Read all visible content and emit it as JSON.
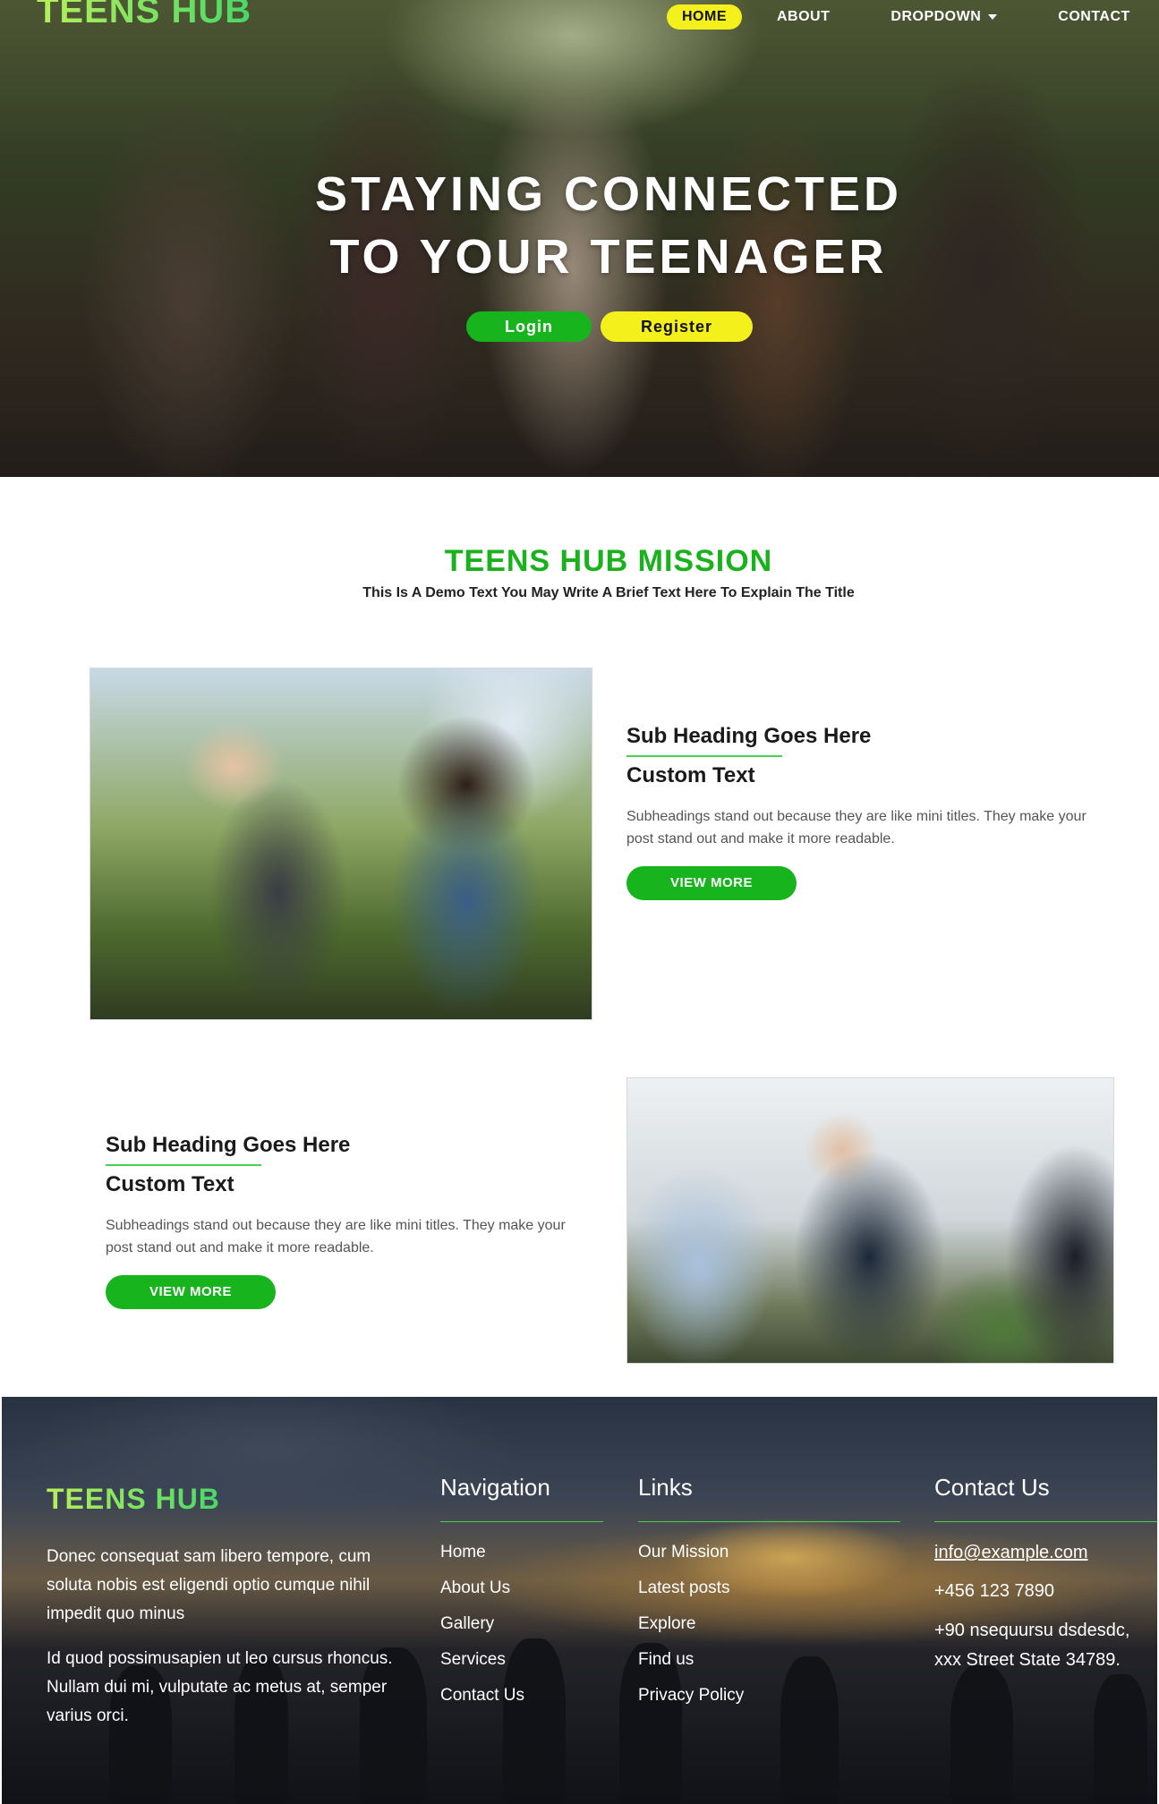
{
  "header": {
    "logo": "TEENS HUB",
    "nav": {
      "home": "HOME",
      "about": "ABOUT",
      "dropdown": "DROPDOWN",
      "contact": "CONTACT"
    }
  },
  "hero": {
    "title_line1": "STAYING CONNECTED",
    "title_line2": "TO YOUR TEENAGER",
    "login_label": "Login",
    "register_label": "Register"
  },
  "mission": {
    "title": "TEENS HUB MISSION",
    "subtitle": "This Is A Demo Text You May Write A Brief Text Here To Explain The Title"
  },
  "features": [
    {
      "sub_heading": "Sub Heading Goes Here",
      "custom_text": "Custom Text",
      "description": "Subheadings stand out because they are like mini titles. They make your post stand out and make it more readable.",
      "button_label": "VIEW MORE"
    },
    {
      "sub_heading": "Sub Heading Goes Here",
      "custom_text": "Custom Text",
      "description": "Subheadings stand out because they are like mini titles. They make your post stand out and make it more readable.",
      "button_label": "VIEW MORE"
    }
  ],
  "footer": {
    "logo": "TEENS HUB",
    "para1": "Donec consequat sam libero tempore, cum soluta nobis est eligendi optio cumque nihil impedit quo minus",
    "para2": "Id quod possimusapien ut leo cursus rhoncus. Nullam dui mi, vulputate ac metus at, semper varius orci.",
    "navigation": {
      "title": "Navigation",
      "items": [
        "Home",
        "About Us",
        "Gallery",
        "Services",
        "Contact Us"
      ]
    },
    "links": {
      "title": "Links",
      "items": [
        "Our Mission",
        "Latest posts",
        "Explore",
        "Find us",
        "Privacy Policy"
      ]
    },
    "contact": {
      "title": "Contact Us",
      "email": "info@example.com",
      "phone": "+456 123 7890",
      "address_line1": "+90 nsequursu dsdesdc,",
      "address_line2": "xxx Street State 34789."
    }
  },
  "colors": {
    "accent_green": "#17b41e",
    "accent_yellow": "#f4f01c",
    "divider_green": "#4cd14f"
  }
}
